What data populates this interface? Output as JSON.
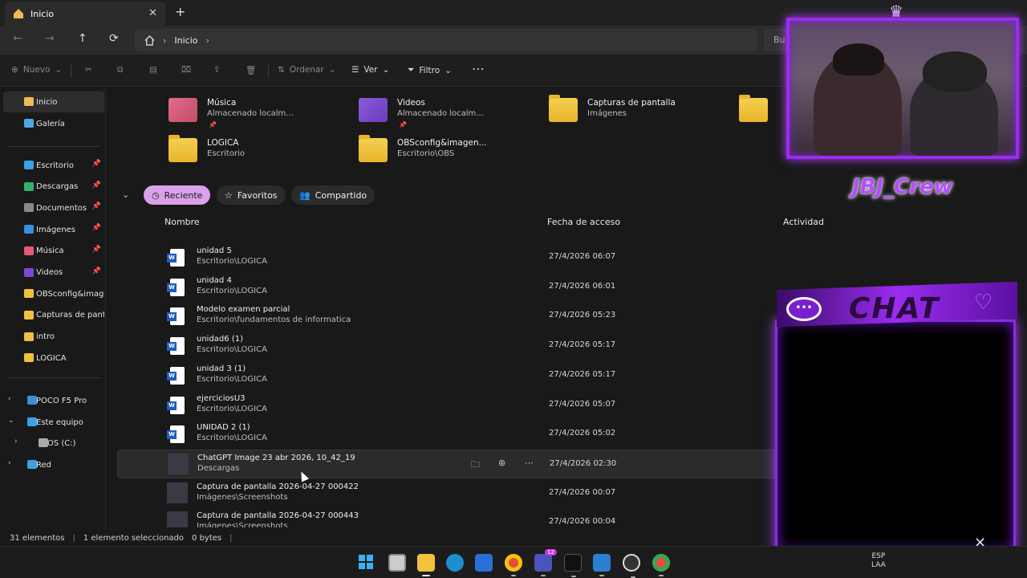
{
  "tab": {
    "title": "Inicio",
    "close": "✕",
    "new": "+"
  },
  "nav": {
    "back": "←",
    "forward": "→",
    "up": "↑",
    "refresh": "⟳",
    "home_icon": "home-icon",
    "crumb": "Inicio",
    "search": "Bu"
  },
  "commands": {
    "nuevo": "Nuevo",
    "ordenar": "Ordenar",
    "ver": "Ver",
    "filtro": "Filtro",
    "more": "⋯"
  },
  "sidebar": {
    "top": [
      {
        "label": "Inicio",
        "icon": "home-icon"
      },
      {
        "label": "Galería",
        "icon": "gallery-icon"
      }
    ],
    "pinned": [
      {
        "label": "Escritorio",
        "icon": "desktop-icon",
        "color": "#3aa0e8"
      },
      {
        "label": "Descargas",
        "icon": "download-icon",
        "color": "#2fb36b"
      },
      {
        "label": "Documentos",
        "icon": "document-icon",
        "color": "#8a8a8a"
      },
      {
        "label": "Imágenes",
        "icon": "image-icon",
        "color": "#3a8fe0"
      },
      {
        "label": "Música",
        "icon": "music-icon",
        "color": "#e05a7a"
      },
      {
        "label": "Videos",
        "icon": "video-icon",
        "color": "#7a4ad0"
      },
      {
        "label": "OBSconfig&imagen",
        "icon": "folder-icon",
        "color": "#f0c040"
      },
      {
        "label": "Capturas de pantall",
        "icon": "folder-icon",
        "color": "#f0c040"
      },
      {
        "label": "intro",
        "icon": "folder-icon",
        "color": "#f0c040"
      },
      {
        "label": "LOGICA",
        "icon": "folder-icon",
        "color": "#f0c040"
      }
    ],
    "devices": [
      {
        "label": "POCO F5 Pro",
        "icon": "phone-icon"
      },
      {
        "label": "Este equipo",
        "icon": "computer-icon"
      },
      {
        "label": "OS (C:)",
        "icon": "drive-icon"
      },
      {
        "label": "Red",
        "icon": "network-icon"
      }
    ]
  },
  "quick_access": [
    {
      "name": "Música",
      "sub": "Almacenado localm...",
      "kind": "music"
    },
    {
      "name": "Videos",
      "sub": "Almacenado localm...",
      "kind": "video"
    },
    {
      "name": "Capturas de pantalla",
      "sub": "Imágenes",
      "kind": "folder"
    },
    {
      "name": "LOGICA",
      "sub": "Escritorio",
      "kind": "folder"
    },
    {
      "name": "OBSconfig&imagen...",
      "sub": "Escritorio\\OBS",
      "kind": "folder"
    }
  ],
  "chips": {
    "recent": "Reciente",
    "favorites": "Favoritos",
    "shared": "Compartido"
  },
  "columns": {
    "name": "Nombre",
    "date": "Fecha de acceso",
    "activity": "Actividad"
  },
  "files": [
    {
      "name": "unidad 5",
      "path": "Escritorio\\LOGICA",
      "date": "27/4/2026 06:07",
      "type": "word"
    },
    {
      "name": "unidad 4",
      "path": "Escritorio\\LOGICA",
      "date": "27/4/2026 06:01",
      "type": "word"
    },
    {
      "name": "Modelo examen parcial",
      "path": "Escritorio\\fundamentos de informatica",
      "date": "27/4/2026 05:23",
      "type": "word"
    },
    {
      "name": "unidad6 (1)",
      "path": "Escritorio\\LOGICA",
      "date": "27/4/2026 05:17",
      "type": "word"
    },
    {
      "name": "unidad 3 (1)",
      "path": "Escritorio\\LOGICA",
      "date": "27/4/2026 05:17",
      "type": "word"
    },
    {
      "name": "ejerciciosU3",
      "path": "Escritorio\\LOGICA",
      "date": "27/4/2026 05:07",
      "type": "word"
    },
    {
      "name": "UNIDAD 2 (1)",
      "path": "Escritorio\\LOGICA",
      "date": "27/4/2026 05:02",
      "type": "word"
    },
    {
      "name": "ChatGPT Image 23 abr 2026, 10_42_19",
      "path": "Descargas",
      "date": "27/4/2026 02:30",
      "type": "image"
    },
    {
      "name": "Captura de pantalla 2026-04-27 000422",
      "path": "Imágenes\\Screenshots",
      "date": "27/4/2026 00:07",
      "type": "image"
    },
    {
      "name": "Captura de pantalla 2026-04-27 000443",
      "path": "Imágenes\\Screenshots",
      "date": "27/4/2026 00:04",
      "type": "image"
    }
  ],
  "status": {
    "count": "31 elementos",
    "selected": "1 elemento seleccionado",
    "size": "0 bytes"
  },
  "overlay": {
    "crew": "JBJ_Crew",
    "chat": "CHAT"
  },
  "taskbar": {
    "badge_teams": "12",
    "tray_lang1": "ESP",
    "tray_lang2": "LAA"
  }
}
